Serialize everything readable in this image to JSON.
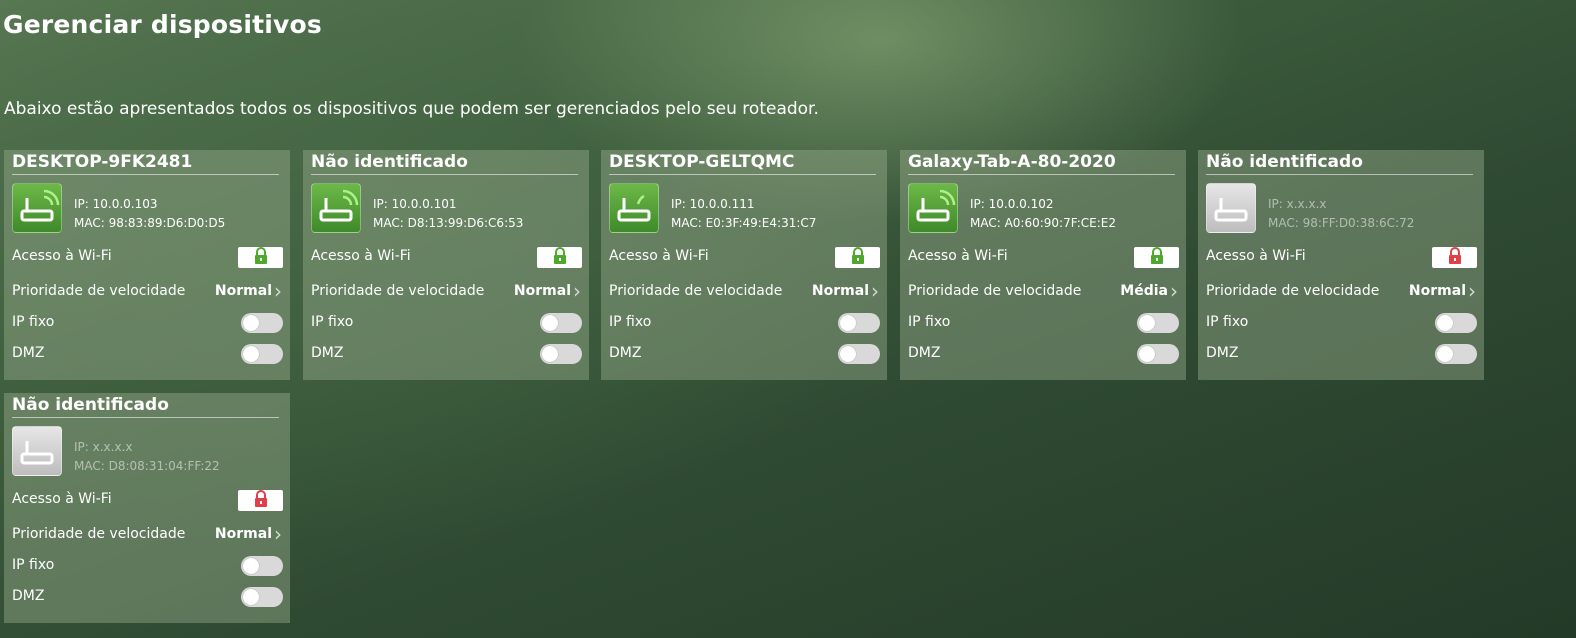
{
  "page": {
    "title": "Gerenciar dispositivos",
    "description": "Abaixo estão apresentados todos os dispositivos que podem ser gerenciados pelo seu roteador."
  },
  "labels": {
    "wifi_access": "Acesso à Wi-Fi",
    "speed_priority": "Prioridade de velocidade",
    "fixed_ip": "IP fixo",
    "dmz": "DMZ"
  },
  "colors": {
    "online_icon": "#4f9e34",
    "lock_unlocked": "#4fa82e",
    "lock_locked": "#e0404a"
  },
  "devices": [
    {
      "name": "DESKTOP-9FK2481",
      "ip": "IP: 10.0.0.103",
      "mac": "MAC: 98:83:89:D6:D0:D5",
      "icon": "router-wifi-icon",
      "online": true,
      "wifi_locked": false,
      "priority": "Normal",
      "fixed_ip": false,
      "dmz": false
    },
    {
      "name": "Não identificado",
      "ip": "IP: 10.0.0.101",
      "mac": "MAC: D8:13:99:D6:C6:53",
      "icon": "router-wifi-icon",
      "online": true,
      "wifi_locked": false,
      "priority": "Normal",
      "fixed_ip": false,
      "dmz": false
    },
    {
      "name": "DESKTOP-GELTQMC",
      "ip": "IP: 10.0.0.111",
      "mac": "MAC: E0:3F:49:E4:31:C7",
      "icon": "router-cable-icon",
      "online": true,
      "wifi_locked": false,
      "priority": "Normal",
      "fixed_ip": false,
      "dmz": false
    },
    {
      "name": "Galaxy-Tab-A-80-2020",
      "ip": "IP: 10.0.0.102",
      "mac": "MAC: A0:60:90:7F:CE:E2",
      "icon": "router-wifi-icon",
      "online": true,
      "wifi_locked": false,
      "priority": "Média",
      "fixed_ip": false,
      "dmz": false
    },
    {
      "name": "Não identificado",
      "ip": "IP: x.x.x.x",
      "mac": "MAC: 98:FF:D0:38:6C:72",
      "icon": "router-offline-icon",
      "online": false,
      "wifi_locked": true,
      "priority": "Normal",
      "fixed_ip": false,
      "dmz": false
    },
    {
      "name": "Não identificado",
      "ip": "IP: x.x.x.x",
      "mac": "MAC: D8:08:31:04:FF:22",
      "icon": "router-offline-icon",
      "online": false,
      "wifi_locked": true,
      "priority": "Normal",
      "fixed_ip": false,
      "dmz": false
    }
  ]
}
